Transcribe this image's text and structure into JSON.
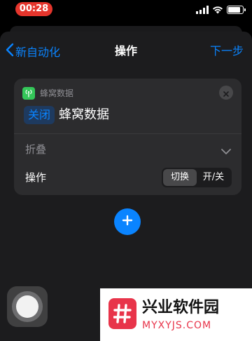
{
  "status_bar": {
    "time": "00:28",
    "signal_icon": "cellular-signal-icon",
    "wifi_icon": "wifi-icon",
    "battery_level": 0.85
  },
  "nav": {
    "back_label": "新自动化",
    "title": "操作",
    "next_label": "下一步"
  },
  "card": {
    "app_name": "蜂窝数据",
    "action_token": "关闭",
    "action_text": "蜂窝数据",
    "collapse_label": "折叠",
    "operation_label": "操作",
    "segmented": {
      "options": [
        "切换",
        "开/关"
      ],
      "selected": "切换"
    }
  },
  "watermark": {
    "title": "兴业软件园",
    "domain": "MYXYJS.COM"
  },
  "colors": {
    "accent": "#0a84ff",
    "app_green": "#34c759",
    "time_pill": "#e5352c",
    "watermark_red": "#e8344a"
  }
}
